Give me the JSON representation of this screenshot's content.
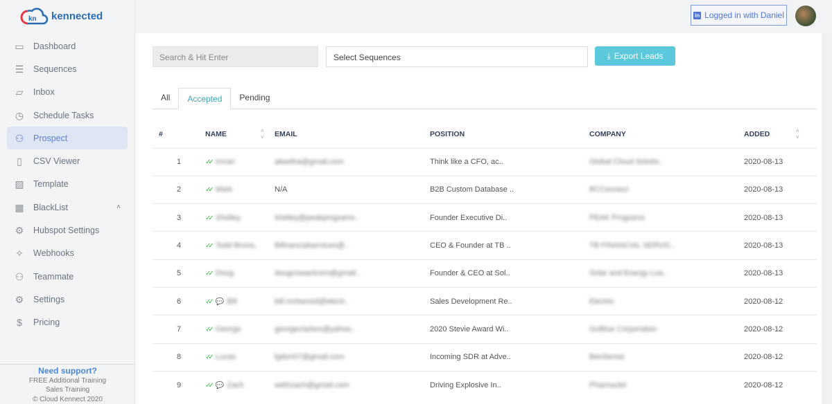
{
  "brand": {
    "name": "kennected",
    "mark": "kn",
    "colors": {
      "blue": "#2b6cb0",
      "red": "#e03a4a",
      "accent": "#5bc8dc",
      "active": "#5b7fd6"
    }
  },
  "sidebar": {
    "items": [
      {
        "label": "Dashboard",
        "icon": "monitor-icon"
      },
      {
        "label": "Sequences",
        "icon": "list-icon"
      },
      {
        "label": "Inbox",
        "icon": "chat-icon"
      },
      {
        "label": "Schedule Tasks",
        "icon": "clock-icon"
      },
      {
        "label": "Prospect",
        "icon": "users-icon",
        "active": true
      },
      {
        "label": "CSV Viewer",
        "icon": "file-icon"
      },
      {
        "label": "Template",
        "icon": "image-icon"
      },
      {
        "label": "BlackList",
        "icon": "grid-icon",
        "expanded": true
      },
      {
        "label": "Hubspot Settings",
        "icon": "gear-icon"
      },
      {
        "label": "Webhooks",
        "icon": "magic-wand-icon"
      },
      {
        "label": "Teammate",
        "icon": "user-icon"
      },
      {
        "label": "Settings",
        "icon": "gear-icon"
      },
      {
        "label": "Pricing",
        "icon": "dollar-icon"
      }
    ],
    "support": {
      "title": "Need support?",
      "line1": "FREE Additional Training",
      "line2": "Sales Training",
      "copyright": "© Cloud Kennect 2020"
    }
  },
  "header": {
    "login_label": "Logged in with Daniel"
  },
  "toolbar": {
    "search_placeholder": "Search & Hit Enter",
    "select_placeholder": "Select Sequences",
    "export_label": "Export Leads"
  },
  "tabs": [
    {
      "label": "All"
    },
    {
      "label": "Accepted",
      "active": true
    },
    {
      "label": "Pending"
    }
  ],
  "table": {
    "columns": [
      "#",
      "NAME",
      "EMAIL",
      "POSITION",
      "COMPANY",
      "ADDED"
    ],
    "rows": [
      {
        "n": "1",
        "name": "Imran",
        "email": "akeelha@gmail.com",
        "position": "Think like a CFO, ac..",
        "company": "Global Cloud Solutio..",
        "added": "2020-08-13",
        "chat": false
      },
      {
        "n": "2",
        "name": "Mark",
        "email": "N/A",
        "position": "B2B Custom Database ..",
        "company": "BCConnect",
        "added": "2020-08-13",
        "chat": false
      },
      {
        "n": "3",
        "name": "Shelley",
        "email": "shelley@peakprograms..",
        "position": "Founder Executive Di..",
        "company": "PEAK Programs",
        "added": "2020-08-13",
        "chat": false
      },
      {
        "n": "4",
        "name": "Todd Bruno,",
        "email": "tbfinancialservices@..",
        "position": "CEO & Founder at TB ..",
        "company": "TB FINANCIAL SERVIC..",
        "added": "2020-08-13",
        "chat": false
      },
      {
        "n": "5",
        "name": "Doug",
        "email": "dougcowanlcom@gmail..",
        "position": "Founder & CEO at Sol..",
        "company": "Solar and Energy Loa..",
        "added": "2020-08-13",
        "chat": false
      },
      {
        "n": "6",
        "name": "Bill",
        "email": "bill.rockwood@electr..",
        "position": "Sales Development Re..",
        "company": "Electric",
        "added": "2020-08-12",
        "chat": true
      },
      {
        "n": "7",
        "name": "George",
        "email": "georgeclarkes@yahoo..",
        "position": "2020 Stevie Award Wi..",
        "company": "GoBlue Corporation",
        "added": "2020-08-12",
        "chat": false
      },
      {
        "n": "8",
        "name": "Lucas",
        "email": "lgdon07@gmail.com",
        "position": "Incoming SDR at Adve..",
        "company": "BeoSense",
        "added": "2020-08-12",
        "chat": false
      },
      {
        "n": "9",
        "name": "Zach",
        "email": "sekhzach@gmail.com",
        "position": "Driving Explosive In..",
        "company": "PharmaJet",
        "added": "2020-08-12",
        "chat": true
      }
    ]
  }
}
